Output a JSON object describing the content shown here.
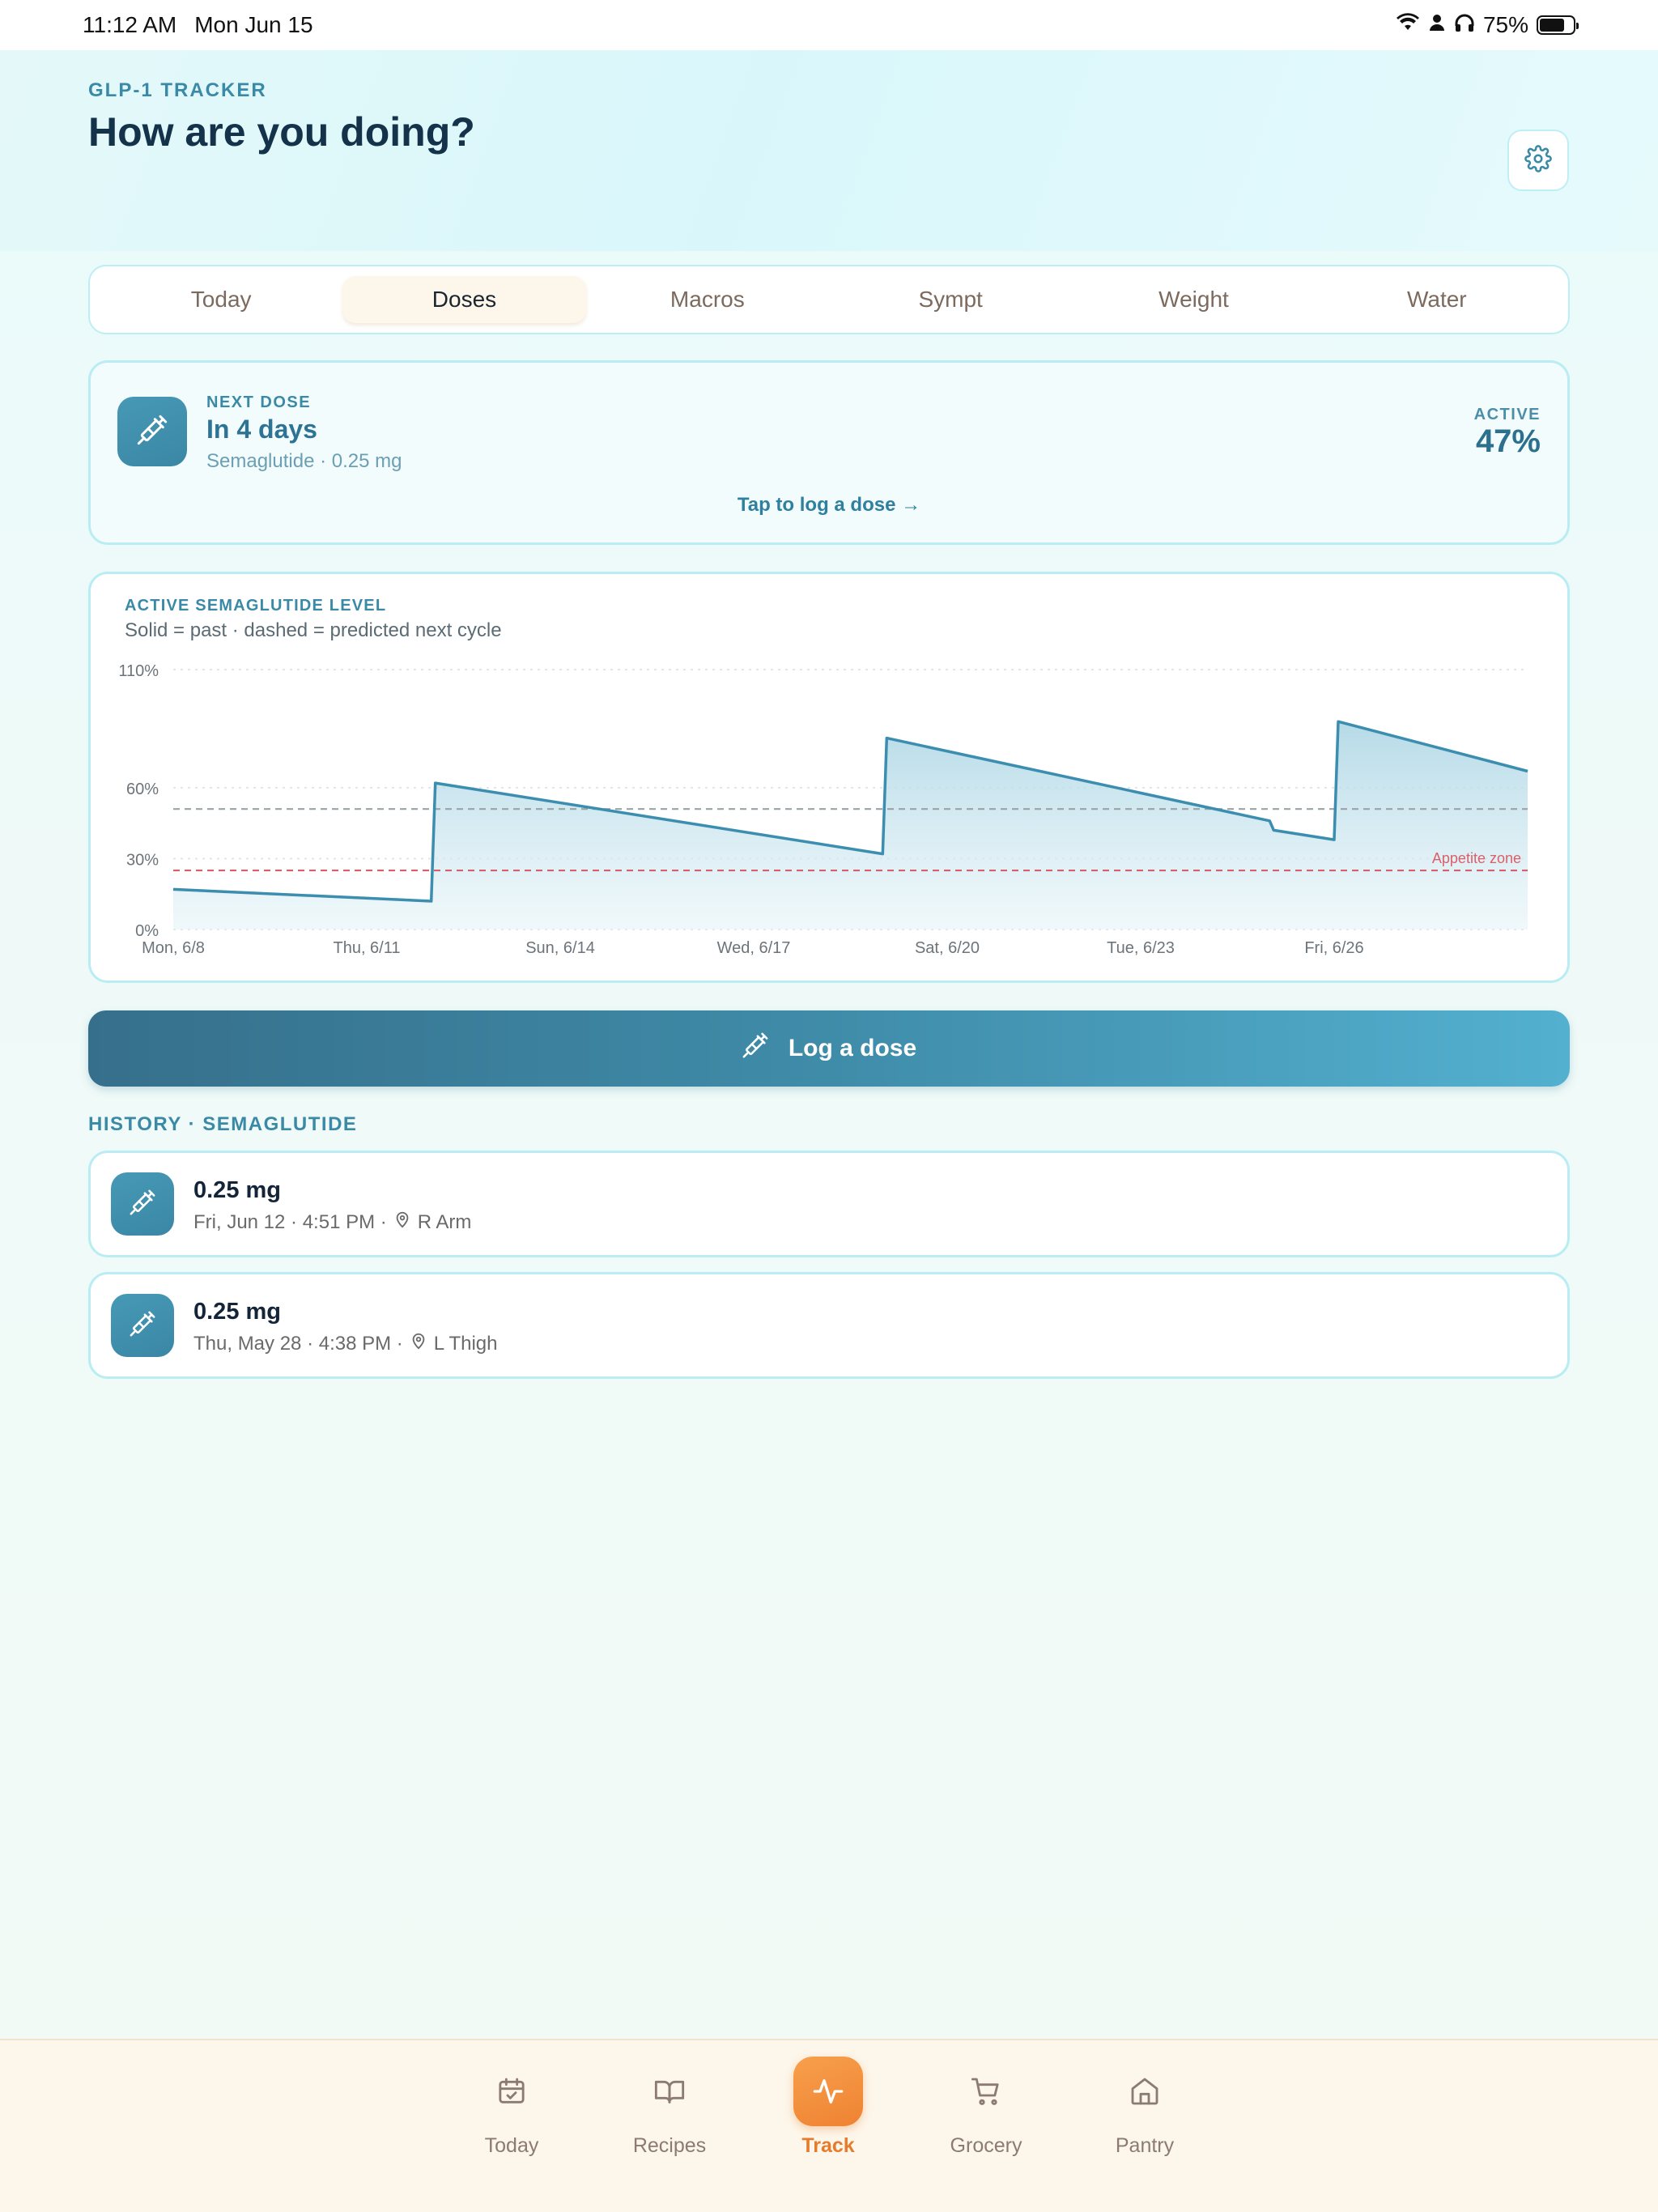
{
  "status_bar": {
    "time": "11:12 AM",
    "date": "Mon Jun 15",
    "battery": "75%",
    "battery_fraction": 0.75
  },
  "header": {
    "eyebrow": "GLP-1 TRACKER",
    "title": "How are you doing?"
  },
  "tabs": [
    {
      "label": "Today",
      "active": false
    },
    {
      "label": "Doses",
      "active": true
    },
    {
      "label": "Macros",
      "active": false
    },
    {
      "label": "Sympt",
      "active": false
    },
    {
      "label": "Weight",
      "active": false
    },
    {
      "label": "Water",
      "active": false
    }
  ],
  "next_dose": {
    "label": "NEXT DOSE",
    "value": "In 4 days",
    "sub": "Semaglutide · 0.25 mg",
    "active_label": "ACTIVE",
    "active_value": "47%",
    "link": "Tap to log a dose →"
  },
  "chart_data": {
    "type": "area",
    "title": "ACTIVE SEMAGLUTIDE LEVEL",
    "subtitle": "Solid = past · dashed = predicted next cycle",
    "xlabel": "",
    "ylabel": "",
    "ylim": [
      0,
      110
    ],
    "yticks": [
      0,
      30,
      60,
      110
    ],
    "ytick_labels": [
      "0%",
      "30%",
      "60%",
      "110%"
    ],
    "xlim": [
      "2026-06-08",
      "2026-06-29"
    ],
    "x_ticks": [
      "2026-06-08",
      "2026-06-11",
      "2026-06-14",
      "2026-06-17",
      "2026-06-20",
      "2026-06-23",
      "2026-06-26"
    ],
    "x_tick_labels": [
      "Mon, 6/8",
      "Thu, 6/11",
      "Sun, 6/14",
      "Wed, 6/17",
      "Sat, 6/20",
      "Tue, 6/23",
      "Fri, 6/26"
    ],
    "grid": true,
    "reference_lines": [
      {
        "y": 51,
        "style": "dashed",
        "color": "#9aa3a8",
        "label": ""
      },
      {
        "y": 25,
        "style": "dashed",
        "color": "#d9606a",
        "label": "Appetite zone"
      }
    ],
    "series": [
      {
        "points": [
          [
            "2026-06-08",
            17
          ],
          [
            "2026-06-12",
            12
          ],
          [
            "2026-06-12",
            62
          ],
          [
            "2026-06-19",
            32
          ],
          [
            "2026-06-19",
            81
          ],
          [
            "2026-06-25",
            46
          ],
          [
            "2026-06-25",
            42
          ],
          [
            "2026-06-26",
            38
          ],
          [
            "2026-06-26",
            88
          ],
          [
            "2026-06-29",
            67
          ]
        ]
      }
    ],
    "colors": {
      "line": "#3b8eaf",
      "fill": "#b3d9e6"
    }
  },
  "log_button": {
    "label": "Log a dose"
  },
  "history": {
    "heading": "HISTORY · SEMAGLUTIDE",
    "items": [
      {
        "amount": "0.25 mg",
        "when": "Fri, Jun 12 · 4:51 PM ·",
        "site": "R Arm"
      },
      {
        "amount": "0.25 mg",
        "when": "Thu, May 28 · 4:38 PM ·",
        "site": "L Thigh"
      }
    ]
  },
  "bottom_nav": [
    {
      "label": "Today",
      "icon": "calendar-check-icon",
      "active": false
    },
    {
      "label": "Recipes",
      "icon": "open-book-icon",
      "active": false
    },
    {
      "label": "Track",
      "icon": "activity-icon",
      "active": true
    },
    {
      "label": "Grocery",
      "icon": "cart-icon",
      "active": false
    },
    {
      "label": "Pantry",
      "icon": "home-icon",
      "active": false
    }
  ],
  "colors": {
    "accent": "#3a8aa7",
    "active_tab_bg": "#fdf6ea",
    "nav_active": "#ef8232"
  }
}
